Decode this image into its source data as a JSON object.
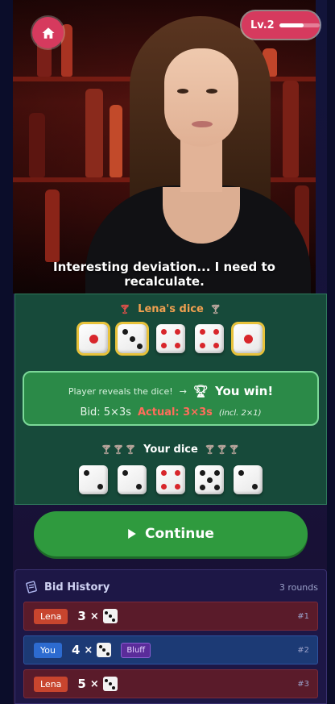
{
  "header": {
    "level_label": "Lv.2",
    "level_progress": 0.6,
    "home_icon": "home-icon"
  },
  "opponent": {
    "speech": "Interesting deviation... I need to recalculate."
  },
  "table": {
    "opponent_dice_title": "Lena's dice",
    "opponent_dice": [
      1,
      3,
      4,
      4,
      1
    ],
    "opponent_highlighted": [
      true,
      true,
      false,
      false,
      true
    ],
    "result": {
      "reveal_text": "Player reveals the dice!",
      "arrow": "→",
      "outcome": "You win!",
      "bid_text": "Bid: 5×3s",
      "actual_text": "Actual: 3×3s",
      "incl_text": "(incl. 2×1)"
    },
    "your_dice_title": "Your dice",
    "your_dice": [
      2,
      2,
      4,
      5,
      2
    ]
  },
  "continue_label": "Continue",
  "history": {
    "title": "Bid History",
    "count": "3 rounds",
    "rows": [
      {
        "player": "Lena",
        "qty": "3",
        "times": "×",
        "face": 3,
        "tag": "",
        "num": "#1"
      },
      {
        "player": "You",
        "qty": "4",
        "times": "×",
        "face": 3,
        "tag": "Bluff",
        "num": "#2"
      },
      {
        "player": "Lena",
        "qty": "5",
        "times": "×",
        "face": 3,
        "tag": "",
        "num": "#3"
      }
    ]
  },
  "colors": {
    "accent": "#d63a5e",
    "felt": "#174a3a",
    "win_box": "#2b8a48",
    "continue": "#2f9a3e",
    "highlight": "#e8c23a"
  }
}
